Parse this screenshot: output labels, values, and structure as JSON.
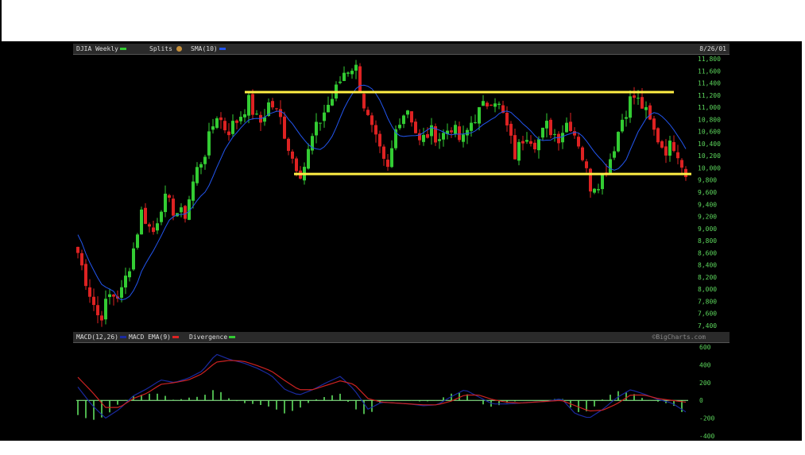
{
  "chart_data": [
    {
      "type": "candlestick",
      "title": "DJIA Weekly",
      "legend": [
        "DJIA Weekly",
        "Splits",
        "SMA(10)"
      ],
      "date": "8/26/01",
      "yticks": [
        11800,
        11600,
        11400,
        11200,
        11000,
        10800,
        10600,
        10400,
        10200,
        10000,
        9800,
        9600,
        9400,
        9200,
        9000,
        8800,
        8600,
        8400,
        8200,
        8000,
        7800,
        7600,
        7400
      ],
      "ylim": [
        7400,
        11800
      ],
      "price_path": [
        8600,
        8000,
        7500,
        7900,
        7900,
        8500,
        9300,
        8900,
        9500,
        9300,
        9200,
        9900,
        10300,
        10900,
        10600,
        10800,
        11100,
        10700,
        11100,
        10800,
        10200,
        9900,
        10500,
        10900,
        11200,
        11600,
        11700,
        10900,
        10400,
        9900,
        10800,
        11000,
        10400,
        10600,
        10500,
        10700,
        10400,
        10800,
        11000,
        11200,
        10800,
        10200,
        10600,
        10400,
        10700,
        10500,
        10800,
        10400,
        9700,
        9800,
        10200,
        10800,
        11200,
        11000,
        10600,
        10300,
        10400,
        9900
      ],
      "resistance": 11250,
      "support": 9900,
      "colors": {
        "up": "#33cc33",
        "down": "#dd2222",
        "sma": "#2255ee",
        "trend": "#ffee44"
      }
    },
    {
      "type": "line",
      "title": "MACD(12,26)",
      "legend": [
        "MACD(12,26)",
        "MACD EMA(9)",
        "Divergence"
      ],
      "watermark": "©BigCharts.com",
      "yticks": [
        600,
        400,
        200,
        0,
        -200,
        -400
      ],
      "ylim": [
        -400,
        600
      ],
      "macd": [
        150,
        -50,
        -200,
        -100,
        50,
        130,
        230,
        200,
        250,
        330,
        520,
        460,
        420,
        360,
        280,
        120,
        60,
        120,
        200,
        270,
        120,
        -100,
        -20,
        -30,
        -40,
        -60,
        -50,
        40,
        120,
        40,
        -40,
        -40,
        -30,
        -20,
        -10,
        20,
        -150,
        -200,
        -100,
        30,
        120,
        70,
        10,
        -30,
        -130
      ],
      "signal": [
        260,
        100,
        -80,
        -80,
        20,
        80,
        180,
        200,
        230,
        300,
        430,
        450,
        440,
        390,
        330,
        220,
        120,
        120,
        170,
        220,
        180,
        20,
        -20,
        -30,
        -40,
        -50,
        -50,
        -10,
        60,
        60,
        10,
        -20,
        -30,
        -20,
        -10,
        0,
        -60,
        -120,
        -110,
        -40,
        60,
        60,
        20,
        0,
        -20
      ]
    }
  ]
}
